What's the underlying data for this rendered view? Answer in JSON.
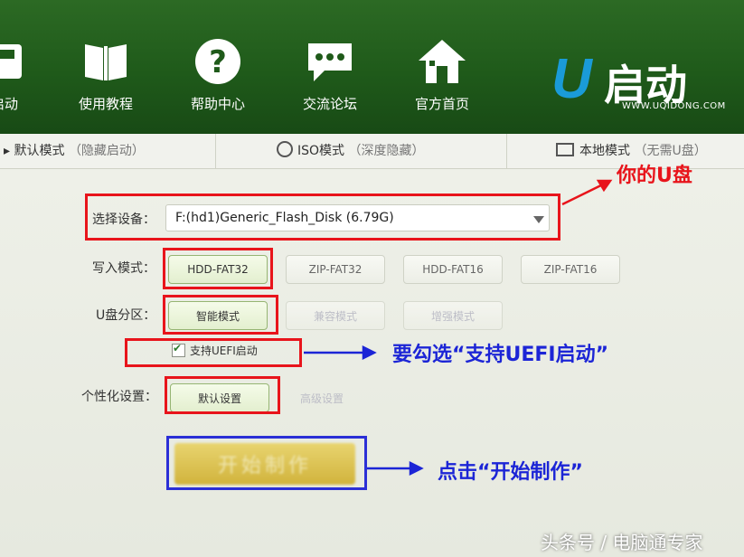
{
  "nav": {
    "items": [
      {
        "label": "启动",
        "icon": "disk-icon"
      },
      {
        "label": "使用教程",
        "icon": "book-icon"
      },
      {
        "label": "帮助中心",
        "icon": "question-icon"
      },
      {
        "label": "交流论坛",
        "icon": "chat-icon"
      },
      {
        "label": "官方首页",
        "icon": "home-icon"
      }
    ],
    "logo": {
      "u": "U",
      "name": "启动",
      "url": "WWW.UQIDONG.COM"
    }
  },
  "tabs": [
    {
      "label": "默认模式",
      "hint": "（隐藏启动）"
    },
    {
      "label": "ISO模式",
      "hint": "（深度隐藏）"
    },
    {
      "label": "本地模式",
      "hint": "（无需U盘）"
    }
  ],
  "form": {
    "device_label": "选择设备：",
    "device_value": "F:(hd1)Generic_Flash_Disk (6.79G)",
    "write_mode_label": "写入模式：",
    "write_modes": [
      "HDD-FAT32",
      "ZIP-FAT32",
      "HDD-FAT16",
      "ZIP-FAT16"
    ],
    "partition_label": "U盘分区：",
    "partition_modes": [
      "智能模式",
      "兼容模式",
      "增强模式"
    ],
    "uefi_label": "支持UEFI启动",
    "personal_label": "个性化设置：",
    "personal_options": [
      "默认设置",
      "高级设置"
    ],
    "start_button": "开始制作"
  },
  "annotations": {
    "device": "你的U盘",
    "uefi": "要勾选“支持UEFI启动”",
    "start": "点击“开始制作”"
  },
  "watermark": "头条号 / 电脑通专家",
  "colors": {
    "header": "#1f5a1a",
    "annotation_red": "#e8141b",
    "annotation_blue": "#1c25d6",
    "logo_blue": "#1a9bd8"
  }
}
